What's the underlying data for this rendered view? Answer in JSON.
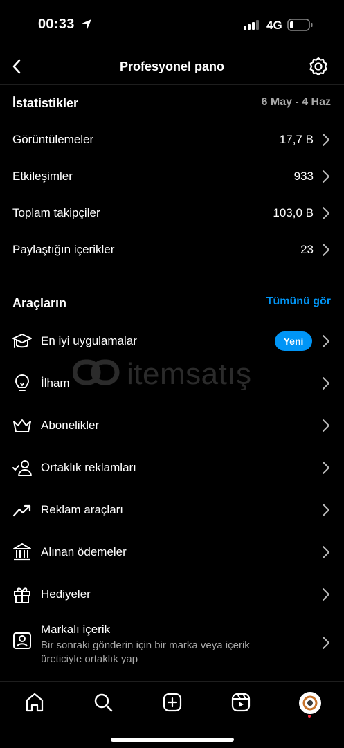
{
  "status_bar": {
    "time": "00:33",
    "network": "4G"
  },
  "header": {
    "title": "Profesyonel pano"
  },
  "stats": {
    "title": "İstatistikler",
    "date_range": "6 May - 4 Haz",
    "rows": [
      {
        "label": "Görüntülemeler",
        "value": "17,7 B"
      },
      {
        "label": "Etkileşimler",
        "value": "933"
      },
      {
        "label": "Toplam takipçiler",
        "value": "103,0 B"
      },
      {
        "label": "Paylaştığın içerikler",
        "value": "23"
      }
    ]
  },
  "tools": {
    "title": "Araçların",
    "see_all": "Tümünü gör",
    "items": [
      {
        "label": "En iyi uygulamalar",
        "icon": "graduation-cap-icon",
        "badge": "Yeni"
      },
      {
        "label": "İlham",
        "icon": "lightbulb-icon"
      },
      {
        "label": "Abonelikler",
        "icon": "crown-icon"
      },
      {
        "label": "Ortaklık reklamları",
        "icon": "partner-check-icon"
      },
      {
        "label": "Reklam araçları",
        "icon": "trending-up-icon"
      },
      {
        "label": "Alınan ödemeler",
        "icon": "bank-icon"
      },
      {
        "label": "Hediyeler",
        "icon": "gift-icon"
      },
      {
        "label": "Markalı içerik",
        "icon": "branded-content-icon",
        "subtitle": "Bir sonraki gönderin için bir marka veya içerik üreticiyle ortaklık yap"
      }
    ]
  },
  "watermark": {
    "text": "itemsatış"
  },
  "tab_bar": [
    "home-icon",
    "search-icon",
    "create-icon",
    "reels-icon",
    "profile-avatar"
  ],
  "colors": {
    "background": "#000000",
    "accent": "#0095f6",
    "secondary_text": "#a8a8a8"
  }
}
